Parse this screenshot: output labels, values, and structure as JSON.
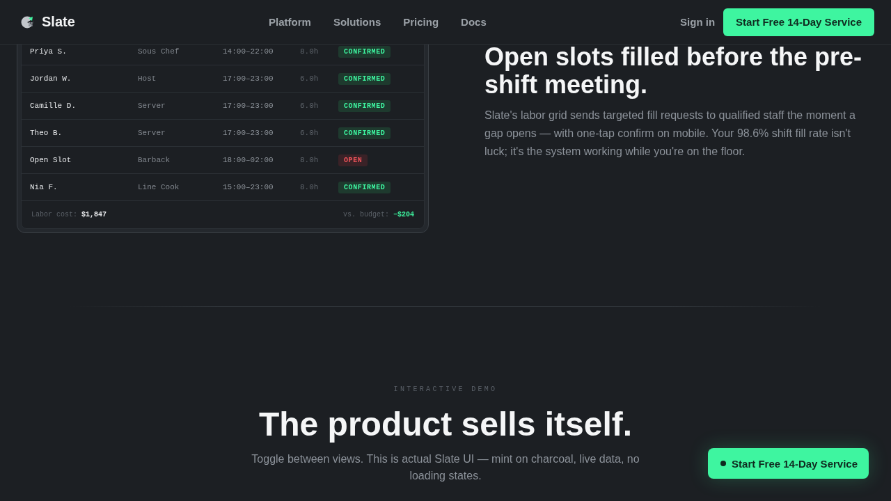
{
  "header": {
    "brand": "Slate",
    "nav": [
      {
        "label": "Platform"
      },
      {
        "label": "Solutions"
      },
      {
        "label": "Pricing"
      },
      {
        "label": "Docs"
      }
    ],
    "sign_in": "Sign in",
    "cta": "Start Free 14-Day Service"
  },
  "schedule_card": {
    "rows": [
      {
        "name": "Priya S.",
        "role": "Sous Chef",
        "shift": "14:00–22:00",
        "hours": "8.0h",
        "status": {
          "label": "CONFIRMED",
          "kind": "confirmed"
        }
      },
      {
        "name": "Jordan W.",
        "role": "Host",
        "shift": "17:00–23:00",
        "hours": "6.0h",
        "status": {
          "label": "CONFIRMED",
          "kind": "confirmed"
        }
      },
      {
        "name": "Camille D.",
        "role": "Server",
        "shift": "17:00–23:00",
        "hours": "6.0h",
        "status": {
          "label": "CONFIRMED",
          "kind": "confirmed"
        }
      },
      {
        "name": "Theo B.",
        "role": "Server",
        "shift": "17:00–23:00",
        "hours": "6.0h",
        "status": {
          "label": "CONFIRMED",
          "kind": "confirmed"
        }
      },
      {
        "name": "Open Slot",
        "role": "Barback",
        "shift": "18:00–02:00",
        "hours": "8.0h",
        "status": {
          "label": "OPEN",
          "kind": "open"
        }
      },
      {
        "name": "Nia F.",
        "role": "Line Cook",
        "shift": "15:00–23:00",
        "hours": "8.0h",
        "status": {
          "label": "CONFIRMED",
          "kind": "confirmed"
        }
      }
    ],
    "footer": {
      "cost_label": "Labor cost:",
      "cost_value": "$1,847",
      "budget_label": "vs. budget:",
      "budget_value": "−$204"
    }
  },
  "feature": {
    "heading": "Open slots filled before the pre-shift meeting.",
    "body": "Slate's labor grid sends targeted fill requests to qualified staff the moment a gap opens — with one-tap confirm on mobile. Your 98.6% shift fill rate isn't luck; it's the system working while you're on the floor."
  },
  "demo_section": {
    "eyebrow": "INTERACTIVE DEMO",
    "heading": "The product sells itself.",
    "subtitle": "Toggle between views. This is actual Slate UI — mint on charcoal, live data, no loading states."
  },
  "floating_cta": {
    "label": "Start Free 14-Day Service"
  }
}
